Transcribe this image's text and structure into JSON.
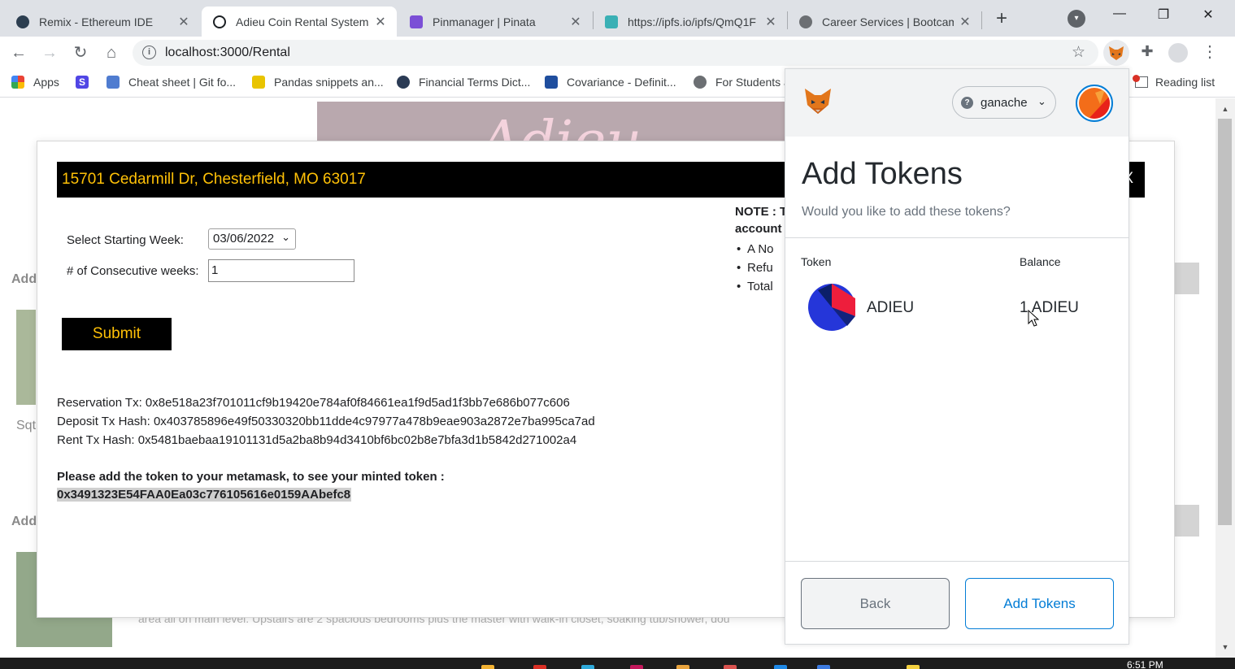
{
  "browser": {
    "tabs": [
      {
        "title": "Remix - Ethereum IDE",
        "icon": "remix-icon",
        "color": "#2c3e50",
        "active": false
      },
      {
        "title": "Adieu Coin Rental Systems",
        "icon": "react-icon",
        "color": "#1b1f23",
        "active": true
      },
      {
        "title": "Pinmanager | Pinata",
        "icon": "pinata-icon",
        "color": "#7b4fd6",
        "active": false
      },
      {
        "title": "https://ipfs.io/ipfs/QmQ1F",
        "icon": "ipfs-icon",
        "color": "#3ab0b5",
        "active": false
      },
      {
        "title": "Career Services | Bootcam",
        "icon": "globe-icon",
        "color": "#6c6f73",
        "active": false
      }
    ],
    "tab_close_glyph": "✕",
    "new_tab_glyph": "+",
    "url": "localhost:3000/Rental",
    "info_glyph": "i",
    "bookmarks": [
      {
        "label": "Apps",
        "icon": "apps-grid-icon",
        "color": "#4285f4"
      },
      {
        "label": "",
        "icon": "s-icon",
        "color": "#5046e5"
      },
      {
        "label": "Cheat sheet | Git fo...",
        "icon": "bookmark-icon",
        "color": "#4f7cd0"
      },
      {
        "label": "Pandas snippets an...",
        "icon": "pandas-icon",
        "color": "#e9c400"
      },
      {
        "label": "Financial Terms Dict...",
        "icon": "investopedia-icon",
        "color": "#2b3b55"
      },
      {
        "label": "Covariance - Definit...",
        "icon": "wallstreet-icon",
        "color": "#1f4e9e"
      },
      {
        "label": "For Students a",
        "icon": "globe-icon",
        "color": "#6c6f73"
      }
    ],
    "reading_list": "Reading list"
  },
  "page": {
    "hero_text": "Adieu",
    "bg_labels": [
      "Add",
      "Sqt",
      "Add"
    ],
    "bg_desc": "area all on main level. Upstairs are 2 spacious bedrooms plus the master with walk-in closet, soaking tub/shower, dou"
  },
  "modal": {
    "address": "15701 Cedarmill Dr, Chesterfield, MO 63017",
    "close_label": "X",
    "start_week_label": "Select Starting Week:",
    "start_week_value": "03/06/2022",
    "weeks_label": "# of Consecutive weeks:",
    "weeks_value": "1",
    "submit_label": "Submit",
    "reservation_tx": "Reservation Tx: 0x8e518a23f701011cf9b19420e784af0f84661ea1f9d5ad1f3bb7e686b077c606",
    "deposit_tx": "Deposit Tx Hash: 0x403785896e49f50330320bb11dde4c97977a478b9eae903a2872e7ba995ca7ad",
    "rent_tx": "Rent Tx Hash: 0x5481baebaa19101131d5a2ba8b94d3410bf6bc02b8e7bfa3d1b5842d271002a4",
    "add_token_msg": "Please add the token to your metamask, to see your minted token :",
    "contract_address": "0x3491323E54FAA0Ea03c776105616e0159AAbefc8",
    "note_title": "NOTE : T",
    "note_line2": "account",
    "note_items": [
      "A No",
      "Refu",
      "Total"
    ]
  },
  "metamask": {
    "network": "ganache",
    "network_glyph": "?",
    "title": "Add Tokens",
    "subtitle": "Would you like to add these tokens?",
    "col_token": "Token",
    "col_balance": "Balance",
    "token_symbol": "ADIEU",
    "token_balance": "1 ADIEU",
    "back_label": "Back",
    "add_label": "Add Tokens",
    "accent": "#037dd6"
  },
  "taskbar": {
    "clock": "6:51 PM"
  }
}
